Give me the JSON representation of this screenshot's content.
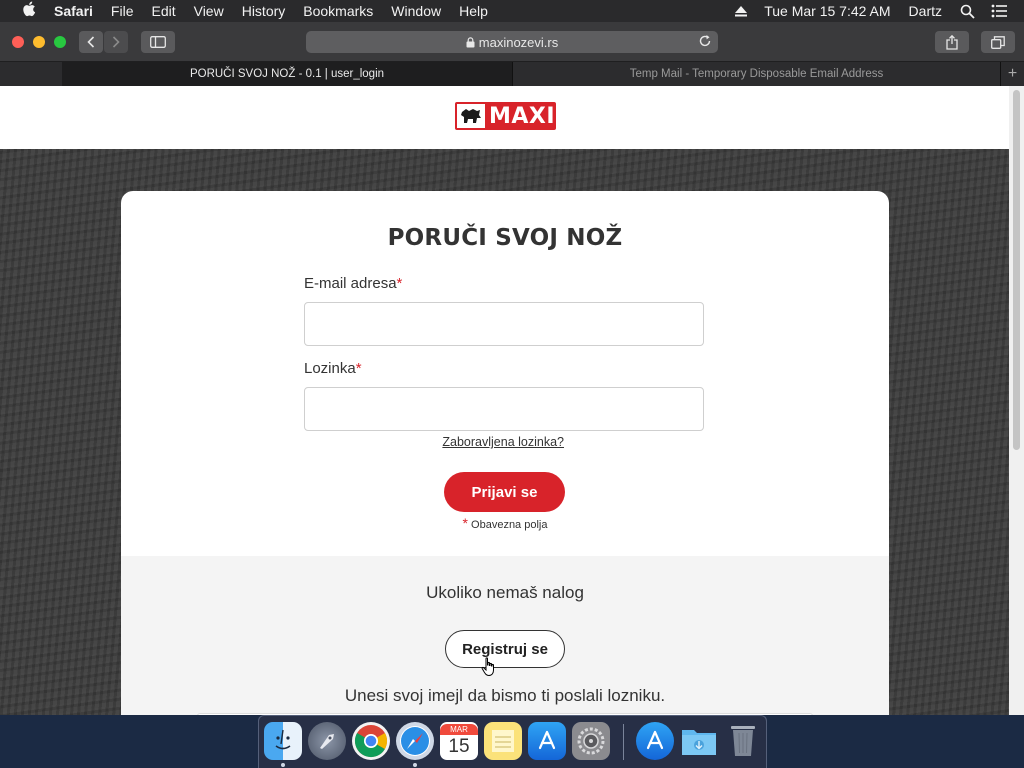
{
  "menubar": {
    "app_name": "Safari",
    "items": [
      "File",
      "Edit",
      "View",
      "History",
      "Bookmarks",
      "Window",
      "Help"
    ],
    "datetime": "Tue Mar 15  7:42 AM",
    "user": "Dartz"
  },
  "browser": {
    "url": "maxinozevi.rs",
    "tabs": [
      {
        "label": "PORUČI SVOJ NOŽ - 0.1 | user_login",
        "active": true
      },
      {
        "label": "Temp Mail - Temporary Disposable Email Address",
        "active": false
      }
    ],
    "new_tab_label": "+"
  },
  "site": {
    "logo_text": "MAXI",
    "brand_color": "#d8232a"
  },
  "login": {
    "title": "PORUČI SVOJ NOŽ",
    "email_label": "E-mail adresa",
    "email_value": "",
    "password_label": "Lozinka",
    "password_value": "",
    "required_mark": "*",
    "forgot_link": "Zaboravljena lozinka?",
    "submit_label": "Prijavi se",
    "required_note": "Obavezna polja"
  },
  "register": {
    "prompt": "Ukoliko nemaš nalog",
    "button_label": "Registruj se",
    "hint": "Unesi svoj imejl da bismo ti poslali lozniku."
  },
  "dock": {
    "calendar_month": "MAR",
    "calendar_day": "15"
  }
}
